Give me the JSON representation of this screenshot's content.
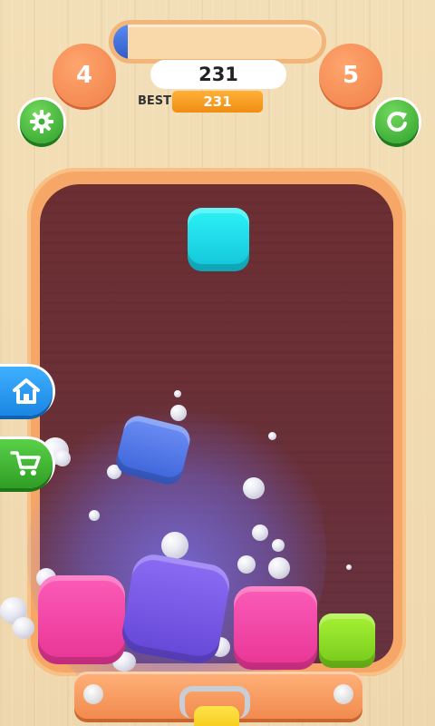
{
  "hud": {
    "level_current": "4",
    "level_next": "5",
    "score": "231",
    "best_label": "BEST",
    "best_value": "231",
    "progress_fraction": 0.07
  },
  "buttons": {
    "settings_icon": "gear-icon",
    "restart_icon": "restart-icon",
    "home_icon": "home-icon",
    "shop_icon": "cart-icon"
  },
  "cubes": [
    {
      "name": "cube-cyan",
      "color": "#1fd8e8"
    },
    {
      "name": "cube-blue",
      "color": "#4f75e6"
    },
    {
      "name": "cube-pink",
      "color": "#f044a6"
    },
    {
      "name": "cube-purple",
      "color": "#7456e3"
    },
    {
      "name": "cube-pink",
      "color": "#f044a6"
    },
    {
      "name": "cube-lime",
      "color": "#8fdc28"
    }
  ],
  "colors": {
    "accent_orange": "#f6a767",
    "board": "#6b2f35",
    "button_green": "#3eb234",
    "button_blue": "#2a9af0"
  }
}
